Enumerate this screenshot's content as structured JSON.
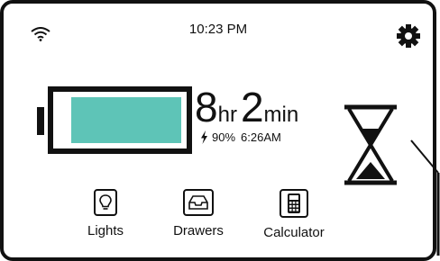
{
  "status_bar": {
    "time": "10:23 PM",
    "wifi_icon": "wifi-icon",
    "settings_icon": "gear-icon"
  },
  "battery": {
    "level_percent": 90,
    "fill_color": "#5ec4b7",
    "remaining_hours": "8",
    "hours_unit": "hr",
    "remaining_minutes": "2",
    "minutes_unit": "min",
    "charge_text": "90%",
    "full_time": "6:26AM"
  },
  "timer_icon": "hourglass-icon",
  "apps": [
    {
      "label": "Lights",
      "icon": "lightbulb-icon"
    },
    {
      "label": "Drawers",
      "icon": "drawer-tray-icon"
    },
    {
      "label": "Calculator",
      "icon": "calculator-icon"
    }
  ]
}
